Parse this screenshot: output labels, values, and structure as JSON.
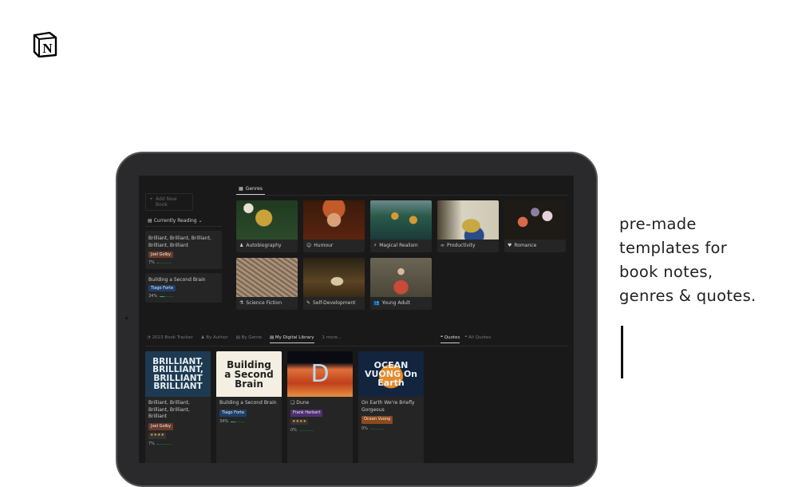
{
  "brand": {
    "logo_letter": "N"
  },
  "tagline": [
    "pre-made",
    "templates for",
    "book notes,",
    "genres & quotes."
  ],
  "sidebar": {
    "add_new": "Add New Book",
    "currently_reading": "Currently Reading",
    "items": [
      {
        "title": "Brilliant, Brilliant, Brilliant, Brilliant, Brilliant",
        "author": "Joel Golby",
        "author_color": "#6b3a2a",
        "progress": "7%",
        "progress_value": 7
      },
      {
        "title": "Building a Second Brain",
        "author": "Tiago Forte",
        "author_color": "#1f3f6a",
        "progress": "34%",
        "progress_value": 34
      }
    ]
  },
  "genres": {
    "tab": "Genres",
    "items": [
      {
        "label": "Autobiography",
        "icon": "person-icon"
      },
      {
        "label": "Humour",
        "icon": "smile-icon"
      },
      {
        "label": "Magical Realism",
        "icon": "wand-icon"
      },
      {
        "label": "Productivity",
        "icon": "link-icon"
      },
      {
        "label": "Romance",
        "icon": "heart-icon"
      },
      {
        "label": "Science Fiction",
        "icon": "flask-icon"
      },
      {
        "label": "Self-Development",
        "icon": "wrench-icon"
      },
      {
        "label": "Young Adult",
        "icon": "people-icon"
      }
    ]
  },
  "views": {
    "tabs": [
      "2023 Book Tracker",
      "By Author",
      "By Genre",
      "My Digital Library",
      "1 more..."
    ],
    "active": "My Digital Library"
  },
  "quotes": {
    "tabs": [
      "Quotes",
      "All Quotes"
    ]
  },
  "library": [
    {
      "cover": "BRILLIANT, BRILLIANT, BRILLIANT BRILLIANT",
      "title": "Brilliant, Brilliant, Brilliant, Brilliant, Brilliant",
      "author": "Joel Golby",
      "author_color": "#6b3a2a",
      "stars": "★★★★",
      "progress": "7%",
      "progress_value": 7
    },
    {
      "cover": "Building a Second Brain",
      "title": "Building a Second Brain",
      "author": "Tiago Forte",
      "author_color": "#1f3f6a",
      "progress": "34%",
      "progress_value": 34
    },
    {
      "cover": "D",
      "title": "Dune",
      "author": "Frank Herbert",
      "author_color": "#4e2f72",
      "stars": "★★★★",
      "progress": "0%",
      "progress_value": 0
    },
    {
      "cover": "OCEAN VUONG On Earth",
      "title": "On Earth We're Briefly Gorgeous",
      "author": "Ocean Vuong",
      "author_color": "#8a4a1c",
      "progress": "0%",
      "progress_value": 0
    }
  ]
}
